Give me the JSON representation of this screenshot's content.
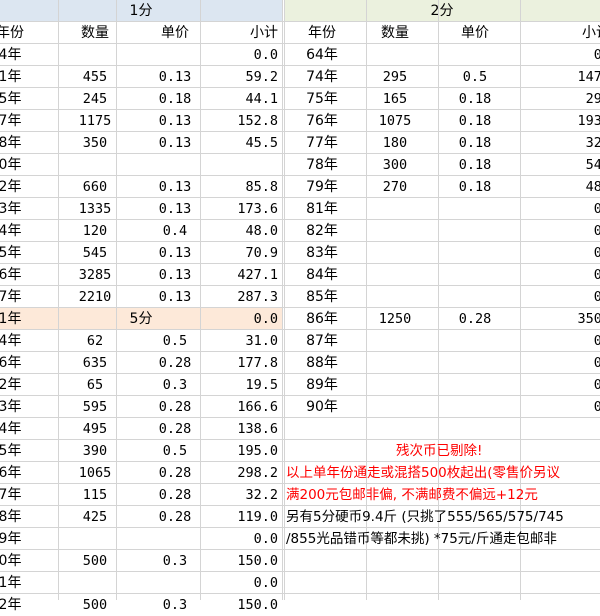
{
  "tables": {
    "one_fen": {
      "title": "1分",
      "headers": [
        "年份",
        "数量",
        "单价",
        "小计"
      ],
      "rows": [
        [
          "4年",
          "",
          "",
          "0.0"
        ],
        [
          "1年",
          "455",
          "0.13",
          "59.2"
        ],
        [
          "5年",
          "245",
          "0.18",
          "44.1"
        ],
        [
          "7年",
          "1175",
          "0.13",
          "152.8"
        ],
        [
          "8年",
          "350",
          "0.13",
          "45.5"
        ],
        [
          "0年",
          "",
          "",
          ""
        ],
        [
          "2年",
          "660",
          "0.13",
          "85.8"
        ],
        [
          "3年",
          "1335",
          "0.13",
          "173.6"
        ],
        [
          "4年",
          "120",
          "0.4",
          "48.0"
        ],
        [
          "5年",
          "545",
          "0.13",
          "70.9"
        ],
        [
          "6年",
          "3285",
          "0.13",
          "427.1"
        ],
        [
          "7年",
          "2210",
          "0.13",
          "287.3"
        ],
        [
          "1年",
          "",
          "",
          "0.0"
        ]
      ]
    },
    "five_fen": {
      "title": "5分",
      "rows": [
        [
          "4年",
          "62",
          "0.5",
          "31.0"
        ],
        [
          "6年",
          "635",
          "0.28",
          "177.8"
        ],
        [
          "2年",
          "65",
          "0.3",
          "19.5"
        ],
        [
          "3年",
          "595",
          "0.28",
          "166.6"
        ],
        [
          "4年",
          "495",
          "0.28",
          "138.6"
        ],
        [
          "5年",
          "390",
          "0.5",
          "195.0"
        ],
        [
          "6年",
          "1065",
          "0.28",
          "298.2"
        ],
        [
          "7年",
          "115",
          "0.28",
          "32.2"
        ],
        [
          "8年",
          "425",
          "0.28",
          "119.0"
        ],
        [
          "9年",
          "",
          "",
          "0.0"
        ],
        [
          "0年",
          "500",
          "0.3",
          "150.0"
        ],
        [
          "1年",
          "",
          "",
          "0.0"
        ],
        [
          "2年",
          "500",
          "0.3",
          "150.0"
        ]
      ]
    },
    "two_fen": {
      "title": "2分",
      "headers": [
        "年份",
        "数量",
        "单价",
        "小计"
      ],
      "rows": [
        [
          "64年",
          "",
          "",
          "0."
        ],
        [
          "74年",
          "295",
          "0.5",
          "147."
        ],
        [
          "75年",
          "165",
          "0.18",
          "29."
        ],
        [
          "76年",
          "1075",
          "0.18",
          "193."
        ],
        [
          "77年",
          "180",
          "0.18",
          "32."
        ],
        [
          "78年",
          "300",
          "0.18",
          "54."
        ],
        [
          "79年",
          "270",
          "0.18",
          "48."
        ],
        [
          "81年",
          "",
          "",
          "0."
        ],
        [
          "82年",
          "",
          "",
          "0."
        ],
        [
          "83年",
          "",
          "",
          "0."
        ],
        [
          "84年",
          "",
          "",
          "0."
        ],
        [
          "85年",
          "",
          "",
          "0."
        ],
        [
          "86年",
          "1250",
          "0.28",
          "350."
        ],
        [
          "87年",
          "",
          "",
          "0."
        ],
        [
          "88年",
          "",
          "",
          "0."
        ],
        [
          "89年",
          "",
          "",
          "0."
        ],
        [
          "90年",
          "",
          "",
          "0."
        ]
      ]
    }
  },
  "notes": {
    "line1": "残次币已剔除!",
    "line2": "以上单年份通走或混搭500枚起出(零售价另议",
    "line3": "满200元包邮非偏, 不满邮费不偏远+12元",
    "line4": "另有5分硬币9.4斤 (只挑了555/565/575/745",
    "line5": "/855光品错币等都未挑) *75元/斤通走包邮非"
  },
  "colors": {
    "header_blue": "#dce6f1",
    "header_green": "#ebf1de",
    "header_orange": "#fde9d9",
    "note_red": "#ff0000",
    "grid": "#d4d4d4"
  }
}
